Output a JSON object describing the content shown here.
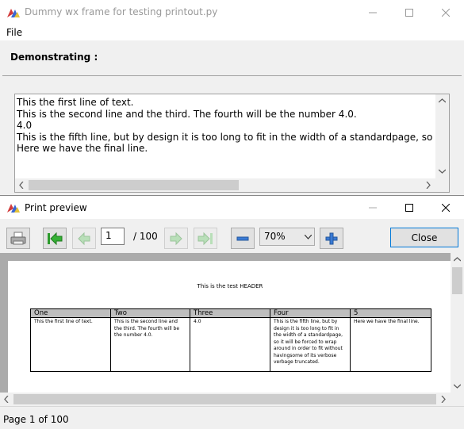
{
  "main_window": {
    "title": "Dummy wx frame for testing printout.py",
    "menu": {
      "file": "File"
    },
    "demo_label": "Demonstrating :",
    "text_lines": [
      "This the first line of text.",
      "This is the second line and the third. The fourth will be the number 4.0.",
      "4.0",
      "This is the fifth line, but by design it is too long to fit in the width of a standardpage, so it will be forced",
      "Here we have the final line."
    ]
  },
  "preview": {
    "title": "Print preview",
    "current_page": "1",
    "total_pages": "/ 100",
    "zoom": "70%",
    "close_label": "Close",
    "status": "Page 1 of 100",
    "page": {
      "header": "This is the test HEADER",
      "columns": [
        "One",
        "Two",
        "Three",
        "Four",
        "5"
      ],
      "cells": [
        "This the first line of text.",
        "This is the second line and the third. The fourth will be the number 4.0.",
        "4.0",
        "This is the fifth line, but by design it is too long to fit in the width of a standardpage, so it will be forced to wrap around in order to fit without havingsome of its verbose verbage truncated.",
        "Here we have the final line."
      ]
    }
  },
  "icons": [
    "app-icon",
    "minimize-icon",
    "maximize-icon",
    "close-icon",
    "print-icon",
    "first-page-icon",
    "prev-page-icon",
    "next-page-icon",
    "last-page-icon",
    "zoom-out-icon",
    "zoom-in-icon",
    "chevron-down-icon"
  ]
}
